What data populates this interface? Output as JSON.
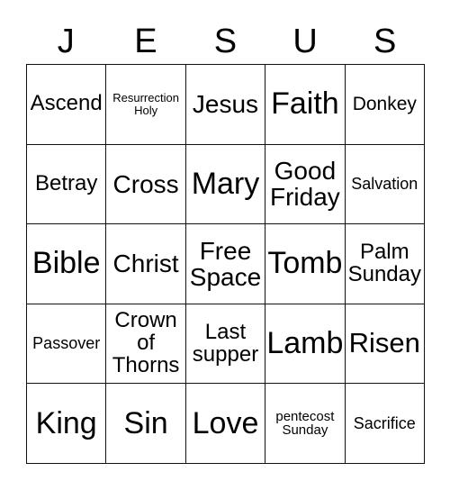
{
  "card": {
    "title_letters": [
      "J",
      "E",
      "S",
      "U",
      "S"
    ],
    "columns": 5,
    "rows": 5,
    "border_color": "#111111",
    "cell_background": "#ffffff",
    "text_color": "#000000",
    "cells": [
      {
        "label": "Ascend",
        "size": "fs-m"
      },
      {
        "label": "Resurrection\nHoly",
        "size": "fs-xxs"
      },
      {
        "label": "Jesus",
        "size": "fs-l"
      },
      {
        "label": "Faith",
        "size": "fs-xxl"
      },
      {
        "label": "Donkey",
        "size": "fs-sm"
      },
      {
        "label": "Betray",
        "size": "fs-m"
      },
      {
        "label": "Cross",
        "size": "fs-l"
      },
      {
        "label": "Mary",
        "size": "fs-xxl"
      },
      {
        "label": "Good\nFriday",
        "size": "fs-l"
      },
      {
        "label": "Salvation",
        "size": "fs-s"
      },
      {
        "label": "Bible",
        "size": "fs-xxl"
      },
      {
        "label": "Christ",
        "size": "fs-l"
      },
      {
        "label": "Free\nSpace",
        "size": "fs-l"
      },
      {
        "label": "Tomb",
        "size": "fs-xxl"
      },
      {
        "label": "Palm\nSunday",
        "size": "fs-m"
      },
      {
        "label": "Passover",
        "size": "fs-s"
      },
      {
        "label": "Crown\nof\nThorns",
        "size": "fs-m"
      },
      {
        "label": "Last\nsupper",
        "size": "fs-m"
      },
      {
        "label": "Lamb",
        "size": "fs-xxl"
      },
      {
        "label": "Risen",
        "size": "fs-xl"
      },
      {
        "label": "King",
        "size": "fs-xxl"
      },
      {
        "label": "Sin",
        "size": "fs-xxl"
      },
      {
        "label": "Love",
        "size": "fs-xxl"
      },
      {
        "label": "pentecost\nSunday",
        "size": "fs-xs"
      },
      {
        "label": "Sacrifice",
        "size": "fs-s"
      }
    ]
  }
}
